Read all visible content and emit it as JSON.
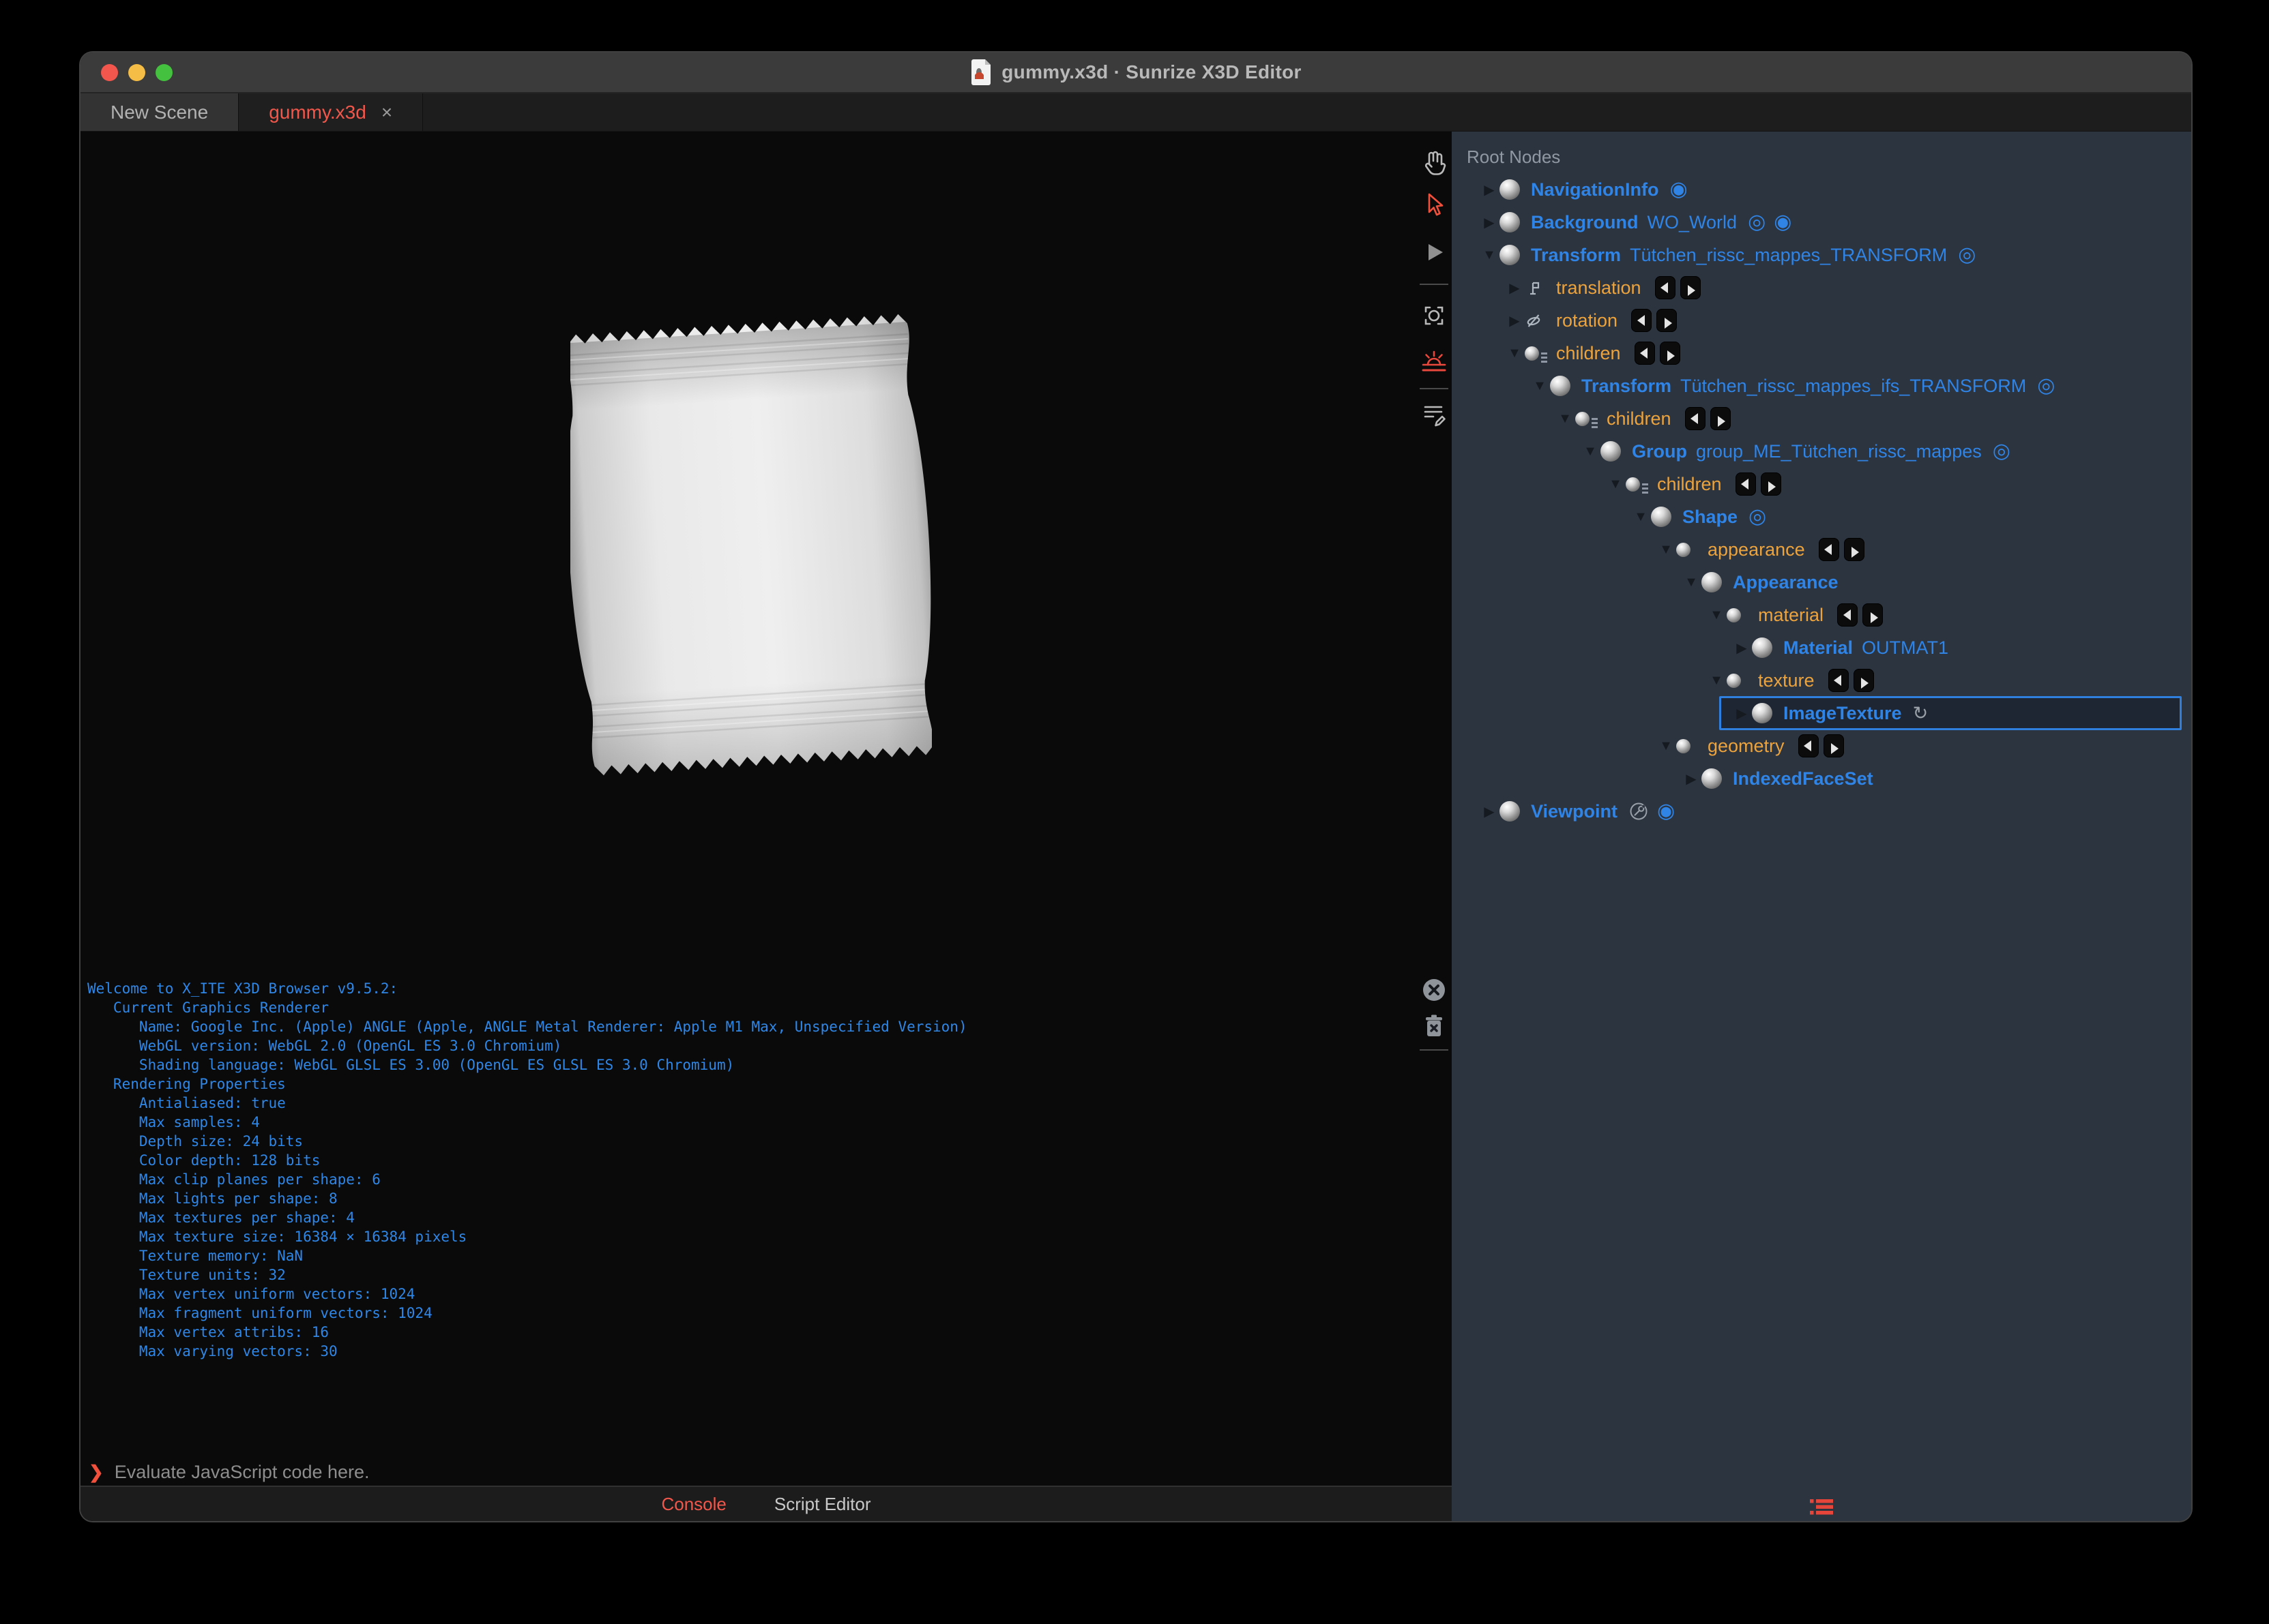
{
  "titlebar": {
    "title": "gummy.x3d · Sunrize X3D Editor"
  },
  "tabs": {
    "items": [
      {
        "label": "New Scene",
        "active": false
      },
      {
        "label": "gummy.x3d",
        "active": true
      }
    ],
    "close_glyph": "×"
  },
  "console": {
    "lines": [
      "Welcome to X_ITE X3D Browser v9.5.2:",
      "   Current Graphics Renderer",
      "      Name: Google Inc. (Apple) ANGLE (Apple, ANGLE Metal Renderer: Apple M1 Max, Unspecified Version)",
      "      WebGL version: WebGL 2.0 (OpenGL ES 3.0 Chromium)",
      "      Shading language: WebGL GLSL ES 3.00 (OpenGL ES GLSL ES 3.0 Chromium)",
      "   Rendering Properties",
      "      Antialiased: true",
      "      Max samples: 4",
      "      Depth size: 24 bits",
      "      Color depth: 128 bits",
      "      Max clip planes per shape: 6",
      "      Max lights per shape: 8",
      "      Max textures per shape: 4",
      "      Max texture size: 16384 × 16384 pixels",
      "      Texture memory: NaN",
      "      Texture units: 32",
      "      Max vertex uniform vectors: 1024",
      "      Max fragment uniform vectors: 1024",
      "      Max vertex attribs: 16",
      "      Max varying vectors: 30"
    ],
    "prompt_glyph": "❯",
    "prompt_placeholder": "Evaluate JavaScript code here."
  },
  "footer_tabs": [
    {
      "label": "Console",
      "active": true
    },
    {
      "label": "Script Editor",
      "active": false
    }
  ],
  "viewport_tools": [
    {
      "name": "pan-hand-icon"
    },
    {
      "name": "select-arrow-icon"
    },
    {
      "name": "play-icon"
    },
    {
      "name": "fit-view-icon"
    },
    {
      "name": "sunrise-icon"
    },
    {
      "name": "script-edit-icon"
    },
    {
      "name": "clear-console-icon"
    },
    {
      "name": "trash-icon"
    }
  ],
  "outline": {
    "header": "Root Nodes",
    "rows": [
      {
        "level": 0,
        "expander": "closed",
        "icon": "node",
        "type": "NavigationInfo",
        "badges": [
          "bound"
        ]
      },
      {
        "level": 0,
        "expander": "closed",
        "icon": "node",
        "type": "Background",
        "def": "WO_World",
        "badges": [
          "visibility",
          "bound"
        ]
      },
      {
        "level": 0,
        "expander": "open",
        "icon": "node",
        "type": "Transform",
        "def": "Tütchen_rissc_mappes_TRANSFORM",
        "badges": [
          "visibility"
        ]
      },
      {
        "level": 1,
        "expander": "closed",
        "icon": "translation",
        "field": "translation",
        "routes": true
      },
      {
        "level": 1,
        "expander": "closed",
        "icon": "rotation",
        "field": "rotation",
        "routes": true
      },
      {
        "level": 1,
        "expander": "open",
        "icon": "mfnode",
        "field": "children",
        "routes": true
      },
      {
        "level": 2,
        "expander": "open",
        "icon": "node",
        "type": "Transform",
        "def": "Tütchen_rissc_mappes_ifs_TRANSFORM",
        "badges": [
          "visibility"
        ]
      },
      {
        "level": 3,
        "expander": "open",
        "icon": "mfnode",
        "field": "children",
        "routes": true
      },
      {
        "level": 4,
        "expander": "open",
        "icon": "node",
        "type": "Group",
        "def": "group_ME_Tütchen_rissc_mappes",
        "badges": [
          "visibility"
        ]
      },
      {
        "level": 5,
        "expander": "open",
        "icon": "mfnode",
        "field": "children",
        "routes": true
      },
      {
        "level": 6,
        "expander": "open",
        "icon": "node",
        "type": "Shape",
        "badges": [
          "visibility"
        ]
      },
      {
        "level": 7,
        "expander": "open",
        "icon": "sfnode",
        "field": "appearance",
        "routes": true
      },
      {
        "level": 8,
        "expander": "open",
        "icon": "node",
        "type": "Appearance"
      },
      {
        "level": 9,
        "expander": "open",
        "icon": "sfnode",
        "field": "material",
        "routes": true
      },
      {
        "level": 10,
        "expander": "closed",
        "icon": "node",
        "type": "Material",
        "def": "OUTMAT1"
      },
      {
        "level": 9,
        "expander": "open",
        "icon": "sfnode",
        "field": "texture",
        "routes": true
      },
      {
        "level": 10,
        "expander": "closed",
        "icon": "node",
        "type": "ImageTexture",
        "selected": true,
        "badges": [
          "reload"
        ]
      },
      {
        "level": 7,
        "expander": "open",
        "icon": "sfnode",
        "field": "geometry",
        "routes": true
      },
      {
        "level": 8,
        "expander": "closed",
        "icon": "node",
        "type": "IndexedFaceSet"
      },
      {
        "level": 0,
        "expander": "closed",
        "icon": "node",
        "type": "Viewpoint",
        "badges": [
          "tool",
          "bound"
        ]
      }
    ]
  },
  "colors": {
    "accent_blue": "#2f84e6",
    "accent_orange": "#eca33c",
    "accent_red": "#f0503c",
    "console_blue": "#2f87e8",
    "panel_bg": "#2c3440"
  }
}
